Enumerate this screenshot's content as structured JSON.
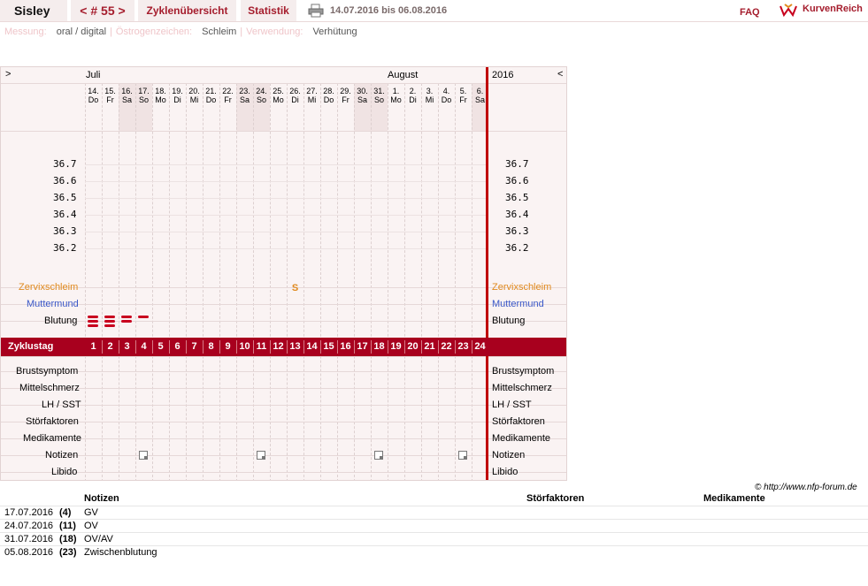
{
  "header": {
    "name": "Sisley",
    "cycle_nav": "< # 55 >",
    "tab_overview": "Zyklenübersicht",
    "tab_stats": "Statistik",
    "date_range": "14.07.2016 bis 06.08.2016",
    "faq": "FAQ",
    "logo_text": "KurvenReich"
  },
  "info": {
    "measure_label": "Messung:",
    "measure_value": "oral / digital",
    "sign_label": "Östrogenzeichen:",
    "sign_value": "Schleim",
    "use_label": "Verwendung:",
    "use_value": "Verhütung"
  },
  "chart": {
    "nav_left": ">",
    "nav_right": "<",
    "month_jul": "Juli",
    "month_aug": "August",
    "year": "2016",
    "days": [
      {
        "d": "14.",
        "w": "Do",
        "we": false
      },
      {
        "d": "15.",
        "w": "Fr",
        "we": false
      },
      {
        "d": "16.",
        "w": "Sa",
        "we": true
      },
      {
        "d": "17.",
        "w": "So",
        "we": true
      },
      {
        "d": "18.",
        "w": "Mo",
        "we": false
      },
      {
        "d": "19.",
        "w": "Di",
        "we": false
      },
      {
        "d": "20.",
        "w": "Mi",
        "we": false
      },
      {
        "d": "21.",
        "w": "Do",
        "we": false
      },
      {
        "d": "22.",
        "w": "Fr",
        "we": false
      },
      {
        "d": "23.",
        "w": "Sa",
        "we": true
      },
      {
        "d": "24.",
        "w": "So",
        "we": true
      },
      {
        "d": "25.",
        "w": "Mo",
        "we": false
      },
      {
        "d": "26.",
        "w": "Di",
        "we": false
      },
      {
        "d": "27.",
        "w": "Mi",
        "we": false
      },
      {
        "d": "28.",
        "w": "Do",
        "we": false
      },
      {
        "d": "29.",
        "w": "Fr",
        "we": false
      },
      {
        "d": "30.",
        "w": "Sa",
        "we": true
      },
      {
        "d": "31.",
        "w": "So",
        "we": true
      },
      {
        "d": "1.",
        "w": "Mo",
        "we": false
      },
      {
        "d": "2.",
        "w": "Di",
        "we": false
      },
      {
        "d": "3.",
        "w": "Mi",
        "we": false
      },
      {
        "d": "4.",
        "w": "Do",
        "we": false
      },
      {
        "d": "5.",
        "w": "Fr",
        "we": false
      },
      {
        "d": "6.",
        "w": "Sa",
        "we": true
      }
    ],
    "temps": [
      "36.7",
      "36.6",
      "36.5",
      "36.4",
      "36.3",
      "36.2"
    ],
    "rows": {
      "zervix": "Zervixschleim",
      "muttermund": "Muttermund",
      "blutung": "Blutung",
      "zyklustag": "Zyklustag",
      "brust": "Brustsymptom",
      "mittel": "Mittelschmerz",
      "lh": "LH / SST",
      "stoer": "Störfaktoren",
      "medi": "Medikamente",
      "notizen": "Notizen",
      "libido": "Libido"
    },
    "cervix_marks": [
      {
        "day": 13,
        "symbol": "S"
      }
    ],
    "bleeding": [
      {
        "day": 1,
        "bars": 3
      },
      {
        "day": 2,
        "bars": 3
      },
      {
        "day": 3,
        "bars": 2
      },
      {
        "day": 4,
        "bars": 1
      }
    ],
    "note_days": [
      4,
      11,
      18,
      23
    ],
    "colors": {
      "cervix": "#e08a1e",
      "muttermund": "#3a58c8",
      "accent": "#a8001e"
    }
  },
  "copyright": "© http://www.nfp-forum.de",
  "notes": {
    "col_notizen": "Notizen",
    "col_stoer": "Störfaktoren",
    "col_medi": "Medikamente",
    "entries": [
      {
        "date": "17.07.2016",
        "day": "(4)",
        "text": "GV"
      },
      {
        "date": "24.07.2016",
        "day": "(11)",
        "text": "OV"
      },
      {
        "date": "31.07.2016",
        "day": "(18)",
        "text": "OV/AV"
      },
      {
        "date": "05.08.2016",
        "day": "(23)",
        "text": "Zwischenblutung"
      }
    ]
  }
}
